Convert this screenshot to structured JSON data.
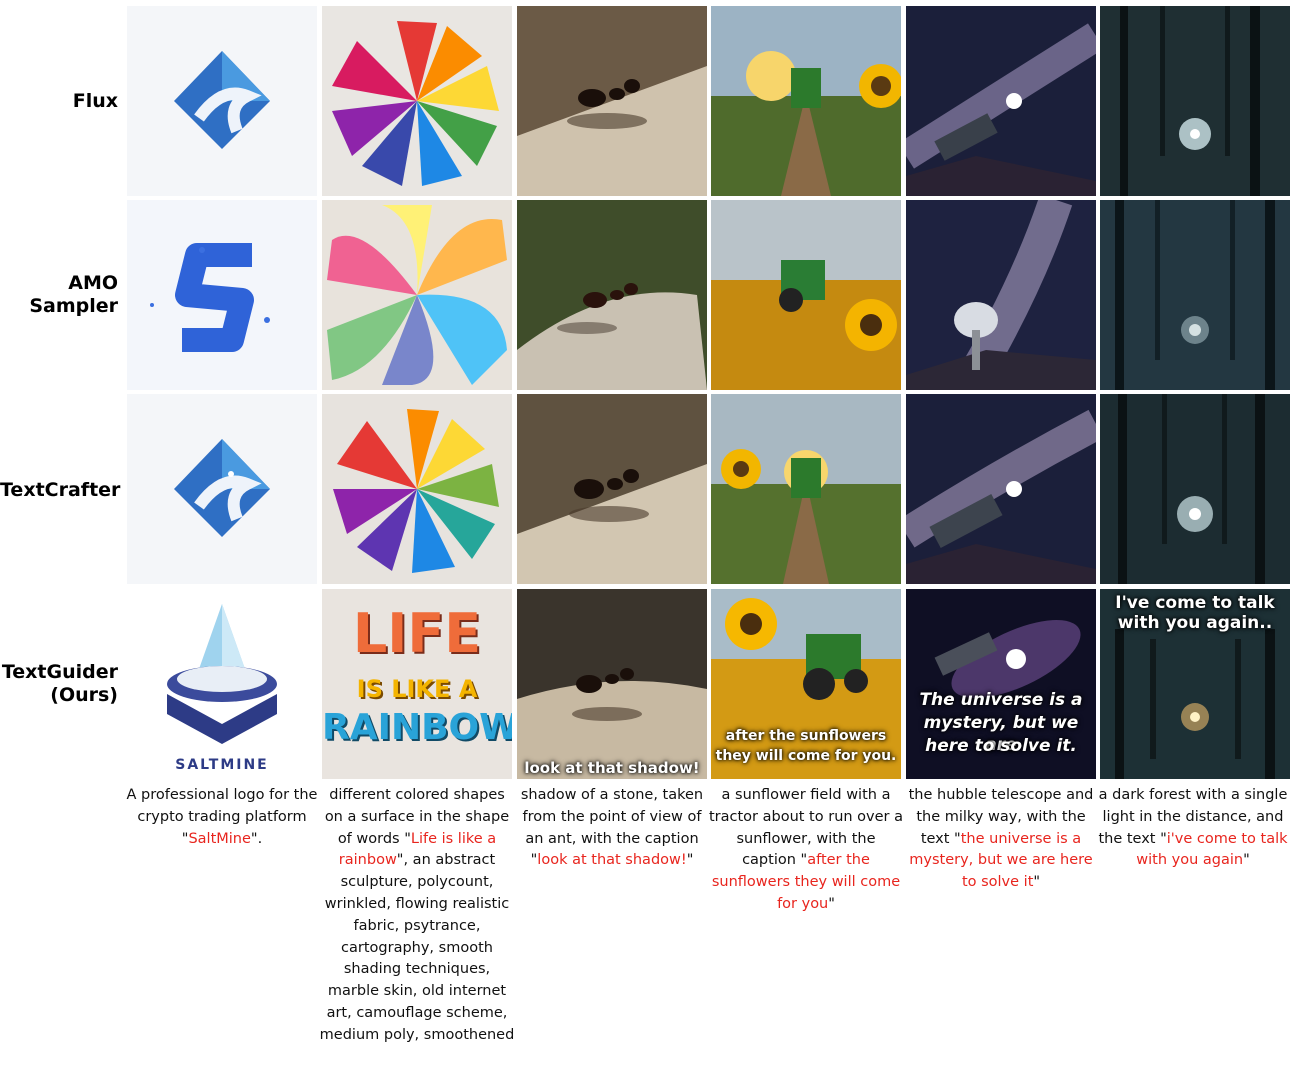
{
  "rows": [
    {
      "label": "Flux"
    },
    {
      "label": "AMO\nSampler"
    },
    {
      "label": "TextCrafter"
    },
    {
      "label": "TextGuider\n(Ours)"
    }
  ],
  "columns": [
    {
      "pre": "A professional logo for the crypto trading platform \"",
      "hl": "SaltMine",
      "post": "\"."
    },
    {
      "pre": "different colored shapes on a surface in the shape of words \"",
      "hl": "Life is like a rainbow",
      "post": "\", an abstract sculpture, polycount, wrinkled, flowing realistic fabric, psytrance, cartography, smooth shading techniques, marble skin, old internet art, camouflage scheme, medium poly, smoothened"
    },
    {
      "pre": "shadow of a stone, taken from the point of view of an ant, with the caption \"",
      "hl": "look at that shadow!",
      "post": "\""
    },
    {
      "pre": "a sunflower field with a tractor about to run over a sunflower, with the caption \"",
      "hl": "after the sunflowers they will come for you",
      "post": "\""
    },
    {
      "pre": "the hubble telescope and the milky way, with the text \"",
      "hl": "the universe is a mystery, but we are here to solve it",
      "post": "\""
    },
    {
      "pre": "a dark forest with a single light in the distance, and the text \"",
      "hl": "i've come to talk with you again",
      "post": "\""
    }
  ],
  "ours_text": {
    "logo_word": "SALTMINE",
    "rainbow_line1": "LIFE",
    "rainbow_line2": "IS LIKE A",
    "rainbow_line3": "RAINBOW",
    "ant_caption": "look at that shadow!",
    "sunflower_caption_1": "after the sunflowers",
    "sunflower_caption_2": "they will come for you.",
    "universe_1": "The universe is a",
    "universe_2": "mystery, but we are",
    "universe_3": "here to solve it.",
    "forest_1": "I've come to talk",
    "forest_2": "with you again.."
  },
  "colors": {
    "highlight": "#e8251e"
  }
}
